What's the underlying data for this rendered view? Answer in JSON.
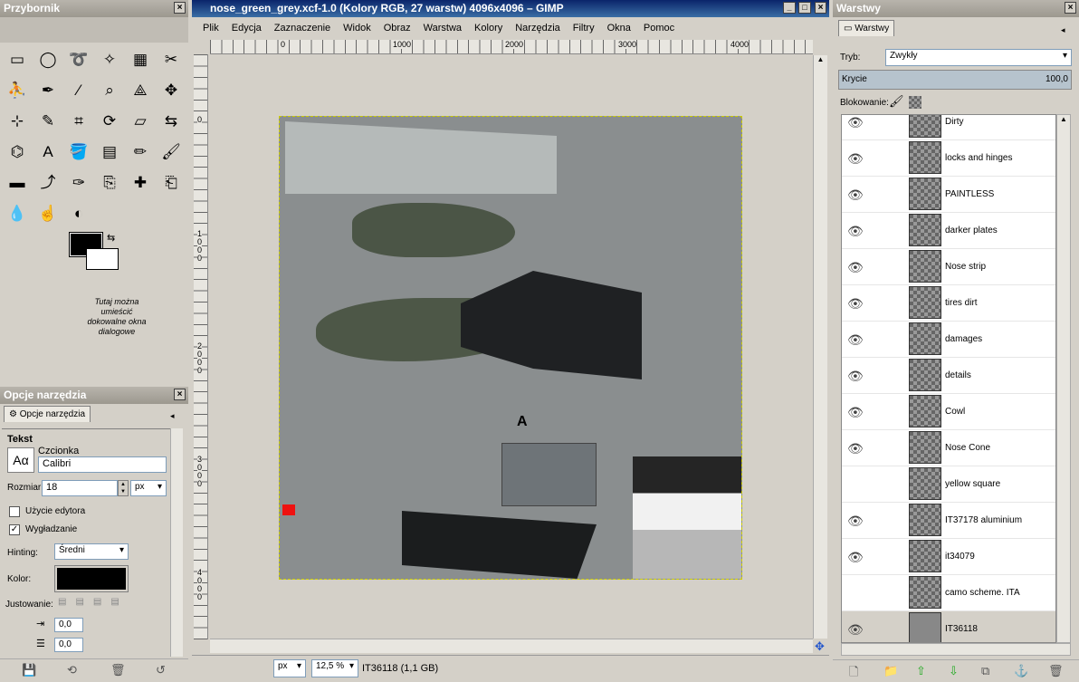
{
  "toolbox": {
    "title": "Przybornik",
    "dock_hint": "Tutaj można umieścić dokowalne okna dialogowe",
    "tools": [
      "rect-select-icon",
      "ellipse-select-icon",
      "lasso-icon",
      "fuzzy-select-icon",
      "color-select-icon",
      "scissors-icon",
      "foreground-select-icon",
      "paths-icon",
      "color-picker-icon",
      "zoom-icon",
      "measure-icon",
      "move-icon",
      "align-icon",
      "knife-icon",
      "crop-icon",
      "rotate-icon",
      "perspective-icon",
      "flip-icon",
      "cage-icon",
      "text-icon",
      "bucket-fill-icon",
      "gradient-icon",
      "pencil-icon",
      "paintbrush-icon",
      "eraser-icon",
      "airbrush-icon",
      "ink-icon",
      "clone-icon",
      "heal-icon",
      "perspective-clone-icon",
      "blur-icon",
      "smudge-icon",
      "dodge-icon"
    ]
  },
  "tool_options": {
    "title": "Opcje narzędzia",
    "tab": "Opcje narzędzia",
    "section": "Tekst",
    "font_label": "Czcionka",
    "font": "Calibri",
    "size_label": "Rozmiar:",
    "size": "18",
    "unit": "px",
    "use_editor": "Użycie edytora",
    "antialias": "Wygładzanie",
    "hinting_label": "Hinting:",
    "hinting": "Średni",
    "color_label": "Kolor:",
    "justify_label": "Justowanie:",
    "indent": "0,0",
    "line_spacing": "0,0"
  },
  "image_window": {
    "title": "nose_green_grey.xcf-1.0 (Kolory RGB, 27 warstw) 4096x4096 – GIMP",
    "menu": [
      "Plik",
      "Edycja",
      "Zaznaczenie",
      "Widok",
      "Obraz",
      "Warstwa",
      "Kolory",
      "Narzędzia",
      "Filtry",
      "Okna",
      "Pomoc"
    ],
    "hruler": [
      "0",
      "1000",
      "2000",
      "3000",
      "4000"
    ],
    "vruler": [
      "0",
      "1\n0\n0\n0",
      "2\n0\n0\n0",
      "3\n0\n0\n0",
      "4\n0\n0\n0"
    ],
    "status_unit": "px",
    "zoom": "12,5 %",
    "status": "IT36118 (1,1 GB)",
    "texture_labels": {
      "text": "A"
    }
  },
  "layers": {
    "title": "Warstwy",
    "tab": "Warstwy",
    "mode_label": "Tryb:",
    "mode": "Zwykły",
    "opacity_label": "Krycie",
    "opacity": "100,0",
    "lock_label": "Blokowanie:",
    "items": [
      {
        "name": "Dirty",
        "visible": true
      },
      {
        "name": "locks and hinges",
        "visible": true
      },
      {
        "name": "PAINTLESS",
        "visible": true
      },
      {
        "name": "darker plates",
        "visible": true
      },
      {
        "name": "Nose strip",
        "visible": true
      },
      {
        "name": "tires dirt",
        "visible": true
      },
      {
        "name": "damages",
        "visible": true
      },
      {
        "name": "details",
        "visible": true
      },
      {
        "name": "Cowl",
        "visible": true
      },
      {
        "name": "Nose Cone",
        "visible": true
      },
      {
        "name": "yellow square",
        "visible": false
      },
      {
        "name": "IT37178 aluminium",
        "visible": true
      },
      {
        "name": "it34079",
        "visible": true
      },
      {
        "name": "camo scheme. ITA",
        "visible": false
      },
      {
        "name": "IT36118",
        "visible": true,
        "selected": true
      }
    ]
  }
}
